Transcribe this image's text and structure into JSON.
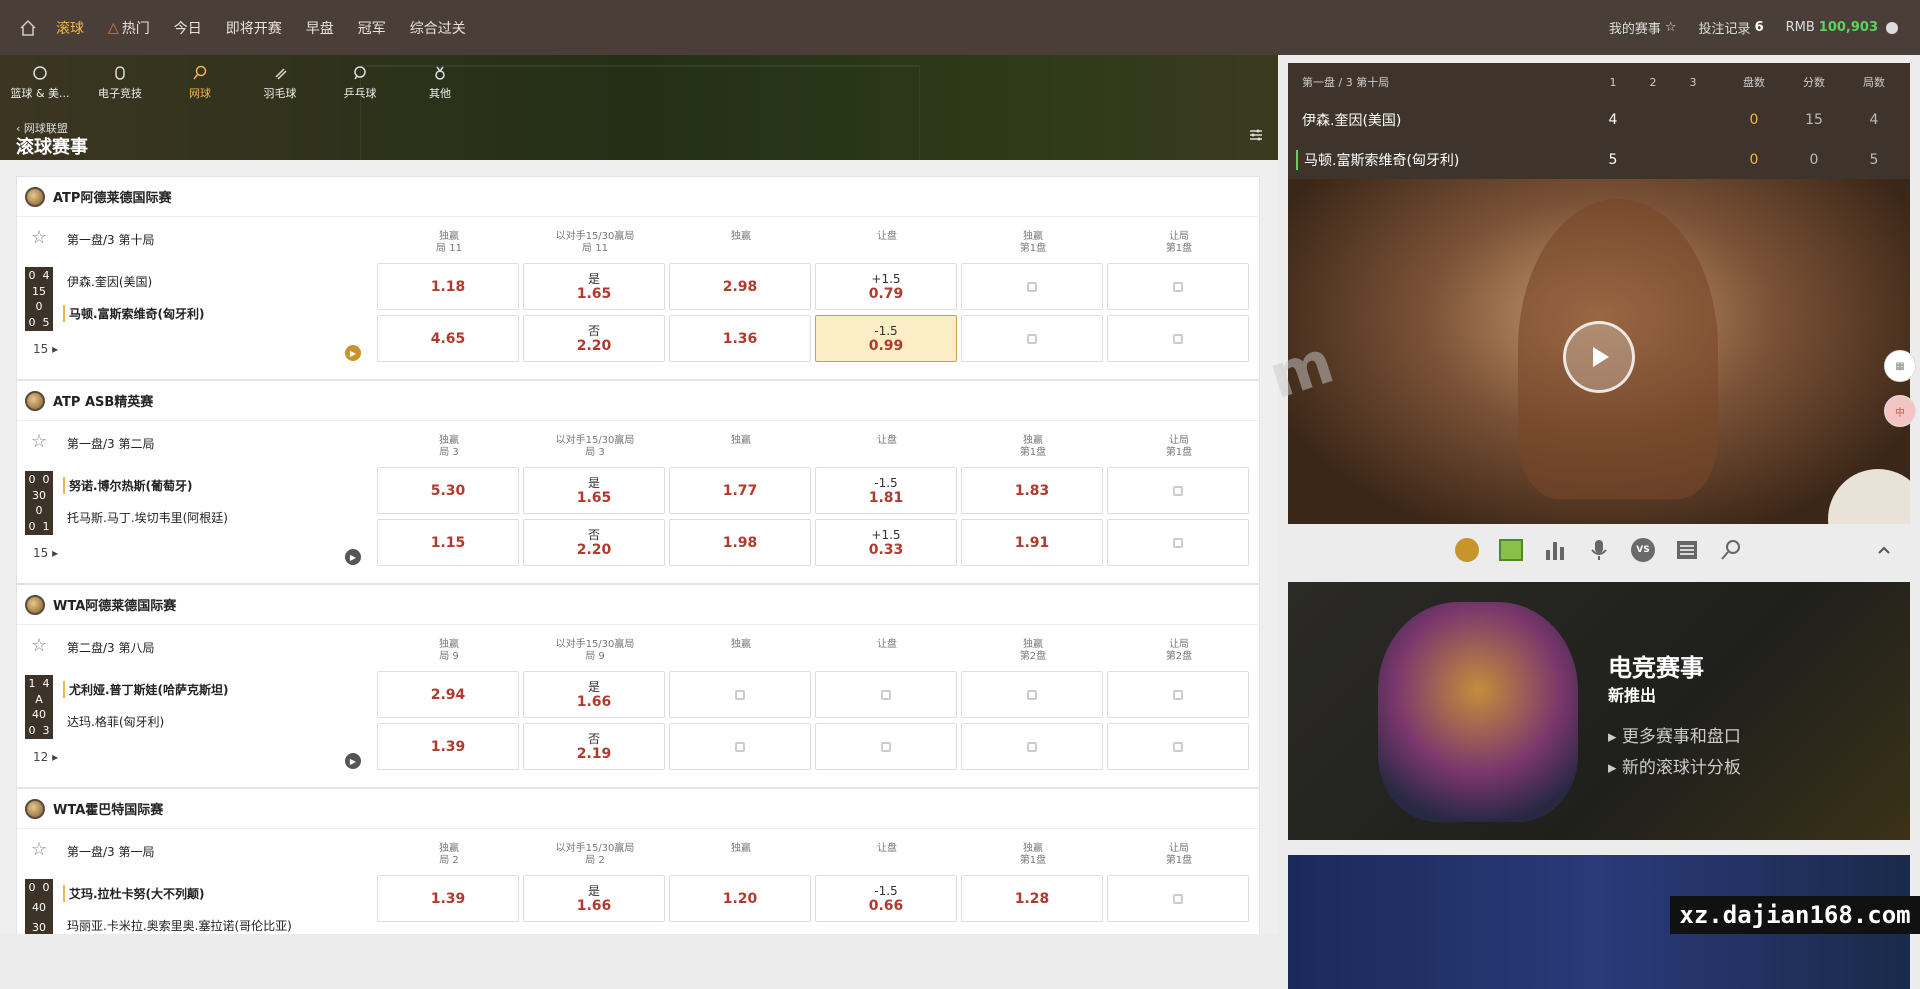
{
  "nav": {
    "items": [
      "滚球",
      "热门",
      "今日",
      "即将开赛",
      "早盘",
      "冠军",
      "综合过关"
    ],
    "active_index": 0,
    "my_events": "我的赛事",
    "bet_record": "投注记录",
    "bet_count": "6",
    "currency": "RMB",
    "balance": "100,903"
  },
  "sports": [
    "篮球 & 美...",
    "电子竞技",
    "网球",
    "羽毛球",
    "乒乓球",
    "其他"
  ],
  "hero": {
    "back": "网球联盟",
    "title": "滚球赛事"
  },
  "leagues": [
    {
      "name": "ATP阿德莱德国际赛",
      "period": "第一盘/3 第十局",
      "score": [
        "0",
        "4",
        "15",
        "0",
        "0",
        "5"
      ],
      "team1": "伊森.奎因(美国)",
      "team2": "马顿.富斯索维奇(匈牙利)",
      "more": "15",
      "cols": [
        [
          "独赢",
          "局 11"
        ],
        [
          "以对手15/30赢局",
          "局 11"
        ],
        [
          "独赢",
          ""
        ],
        [
          "让盘",
          ""
        ],
        [
          "独赢",
          "第1盘"
        ],
        [
          "让局",
          "第1盘"
        ]
      ],
      "row1": [
        [
          "",
          "1.18"
        ],
        [
          "是",
          "1.65"
        ],
        [
          "",
          "2.98"
        ],
        [
          "+1.5",
          "0.79"
        ],
        [
          "lock",
          ""
        ],
        [
          "lock",
          ""
        ]
      ],
      "row2": [
        [
          "",
          "4.65"
        ],
        [
          "否",
          "2.20"
        ],
        [
          "",
          "1.36"
        ],
        [
          "-1.5",
          "0.99"
        ],
        [
          "lock",
          ""
        ],
        [
          "lock",
          ""
        ]
      ]
    },
    {
      "name": "ATP ASB精英赛",
      "period": "第一盘/3 第二局",
      "score": [
        "0",
        "0",
        "30",
        "0",
        "0",
        "1"
      ],
      "team1": "努诺.博尔热斯(葡萄牙)",
      "team2": "托马斯.马丁.埃切韦里(阿根廷)",
      "more": "15",
      "cols": [
        [
          "独赢",
          "局 3"
        ],
        [
          "以对手15/30赢局",
          "局 3"
        ],
        [
          "独赢",
          ""
        ],
        [
          "让盘",
          ""
        ],
        [
          "独赢",
          "第1盘"
        ],
        [
          "让局",
          "第1盘"
        ]
      ],
      "row1": [
        [
          "",
          "5.30"
        ],
        [
          "是",
          "1.65"
        ],
        [
          "",
          "1.77"
        ],
        [
          "-1.5",
          "1.81"
        ],
        [
          "",
          "1.83"
        ],
        [
          "lock",
          ""
        ]
      ],
      "row2": [
        [
          "",
          "1.15"
        ],
        [
          "否",
          "2.20"
        ],
        [
          "",
          "1.98"
        ],
        [
          "+1.5",
          "0.33"
        ],
        [
          "",
          "1.91"
        ],
        [
          "lock",
          ""
        ]
      ]
    },
    {
      "name": "WTA阿德莱德国际赛",
      "period": "第二盘/3 第八局",
      "score": [
        "1",
        "4",
        "A",
        "40",
        "0",
        "3"
      ],
      "team1": "尤利娅.普丁斯娃(哈萨克斯坦)",
      "team2": "达玛.格菲(匈牙利)",
      "more": "12",
      "cols": [
        [
          "独赢",
          "局 9"
        ],
        [
          "以对手15/30赢局",
          "局 9"
        ],
        [
          "独赢",
          ""
        ],
        [
          "让盘",
          ""
        ],
        [
          "独赢",
          "第2盘"
        ],
        [
          "让局",
          "第2盘"
        ]
      ],
      "row1": [
        [
          "",
          "2.94"
        ],
        [
          "是",
          "1.66"
        ],
        [
          "lock",
          ""
        ],
        [
          "lock",
          ""
        ],
        [
          "lock",
          ""
        ],
        [
          "lock",
          ""
        ]
      ],
      "row2": [
        [
          "",
          "1.39"
        ],
        [
          "否",
          "2.19"
        ],
        [
          "lock",
          ""
        ],
        [
          "lock",
          ""
        ],
        [
          "lock",
          ""
        ],
        [
          "lock",
          ""
        ]
      ]
    },
    {
      "name": "WTA霍巴特国际赛",
      "period": "第一盘/3 第一局",
      "score": [
        "0",
        "0",
        "40",
        "30",
        "",
        ""
      ],
      "team1": "艾玛.拉杜卡努(大不列颠)",
      "team2": "玛丽亚.卡米拉.奥索里奥.塞拉诺(哥伦比亚)",
      "more": "",
      "cols": [
        [
          "独赢",
          "局 2"
        ],
        [
          "以对手15/30赢局",
          "局 2"
        ],
        [
          "独赢",
          ""
        ],
        [
          "让盘",
          ""
        ],
        [
          "独赢",
          "第1盘"
        ],
        [
          "让局",
          "第1盘"
        ]
      ],
      "row1": [
        [
          "",
          "1.39"
        ],
        [
          "是",
          "1.66"
        ],
        [
          "",
          "1.20"
        ],
        [
          "-1.5",
          "0.66"
        ],
        [
          "",
          "1.28"
        ],
        [
          "lock",
          ""
        ]
      ],
      "row2": []
    }
  ],
  "scoreboard": {
    "period": "第一盘 / 3  第十局",
    "headers": [
      "1",
      "2",
      "3",
      "盘数",
      "分数",
      "局数"
    ],
    "p1": {
      "name": "伊森.奎因(美国)",
      "s1": "4",
      "sets": "0",
      "points": "15",
      "games": "4"
    },
    "p2": {
      "name": "马顿.富斯索维奇(匈牙利)",
      "s1": "5",
      "sets": "0",
      "points": "0",
      "games": "5"
    }
  },
  "promo": {
    "title": "电竞赛事",
    "subtitle": "新推出",
    "line1": "▸ 更多赛事和盘口",
    "line2": "▸ 新的滚球计分板"
  },
  "watermark": "xz.dajian168.com"
}
